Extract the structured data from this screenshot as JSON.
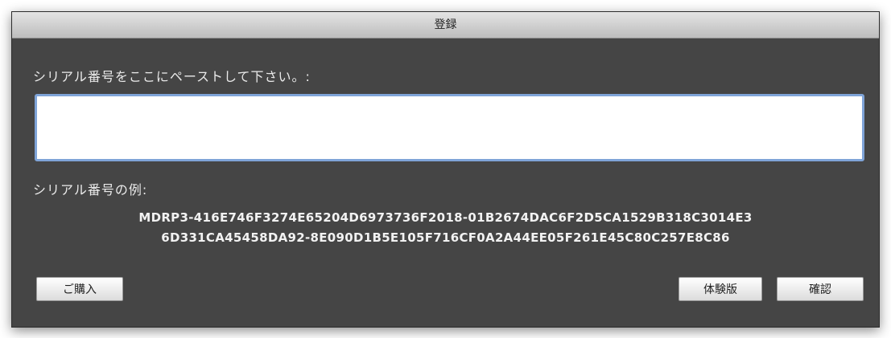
{
  "window": {
    "title": "登録"
  },
  "form": {
    "prompt_label": "シリアル番号をここにペーストして下さい。:",
    "serial_input_value": "",
    "example_label": "シリアル番号の例:",
    "example_serial_line1": "MDRP3-416E746F3274E65204D6973736F2018-01B2674DAC6F2D5CA1529B318C3014E3",
    "example_serial_line2": "6D331CA45458DA92-8E090D1B5E105F716CF0A2A44EE05F261E45C80C257E8C86"
  },
  "buttons": {
    "purchase_label": "ご購入",
    "trial_label": "体験版",
    "confirm_label": "確認"
  }
}
